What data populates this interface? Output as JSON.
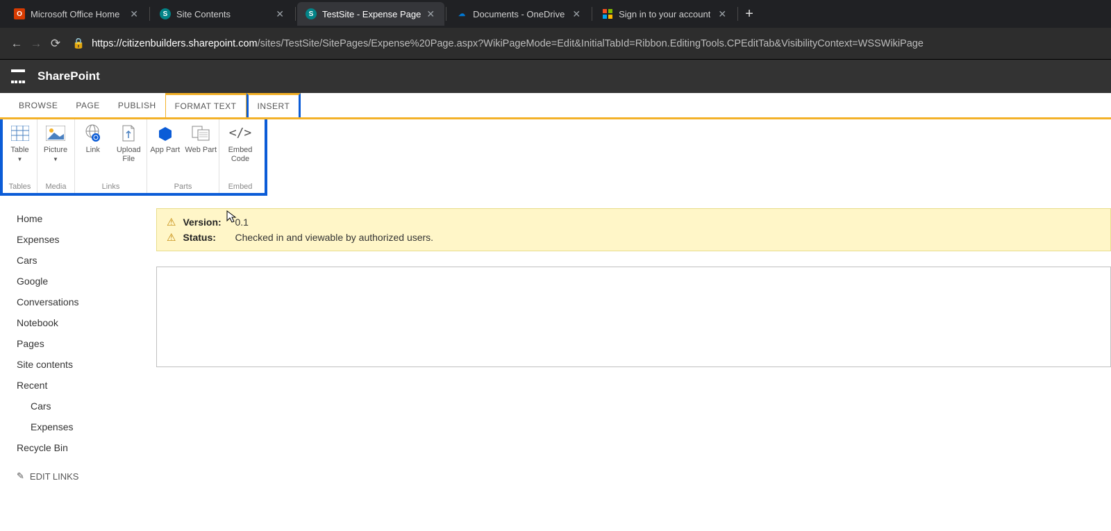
{
  "browser": {
    "tabs": [
      {
        "title": "Microsoft Office Home"
      },
      {
        "title": "Site Contents"
      },
      {
        "title": "TestSite - Expense Page"
      },
      {
        "title": "Documents - OneDrive"
      },
      {
        "title": "Sign in to your account"
      }
    ],
    "url_host": "https://citizenbuilders.sharepoint.com",
    "url_path": "/sites/TestSite/SitePages/Expense%20Page.aspx?WikiPageMode=Edit&InitialTabId=Ribbon.EditingTools.CPEditTab&VisibilityContext=WSSWikiPage"
  },
  "suite": {
    "title": "SharePoint"
  },
  "ribbon": {
    "tabs": [
      "BROWSE",
      "PAGE",
      "PUBLISH",
      "FORMAT TEXT",
      "INSERT"
    ],
    "groups": [
      {
        "label": "Tables",
        "items": [
          {
            "label": "Table",
            "dropdown": true
          }
        ]
      },
      {
        "label": "Media",
        "items": [
          {
            "label": "Picture",
            "dropdown": true
          }
        ]
      },
      {
        "label": "Links",
        "items": [
          {
            "label": "Link"
          },
          {
            "label": "Upload File"
          }
        ]
      },
      {
        "label": "Parts",
        "items": [
          {
            "label": "App Part"
          },
          {
            "label": "Web Part"
          }
        ]
      },
      {
        "label": "Embed",
        "items": [
          {
            "label": "Embed Code"
          }
        ]
      }
    ]
  },
  "leftnav": {
    "items": [
      "Home",
      "Expenses",
      "Cars",
      "Google",
      "Conversations",
      "Notebook",
      "Pages",
      "Site contents",
      "Recent"
    ],
    "sub": [
      "Cars",
      "Expenses"
    ],
    "tail": [
      "Recycle Bin"
    ],
    "edit": "EDIT LINKS"
  },
  "notice": {
    "version_label": "Version:",
    "version_value": "0.1",
    "status_label": "Status:",
    "status_value": "Checked in and viewable by authorized users."
  }
}
